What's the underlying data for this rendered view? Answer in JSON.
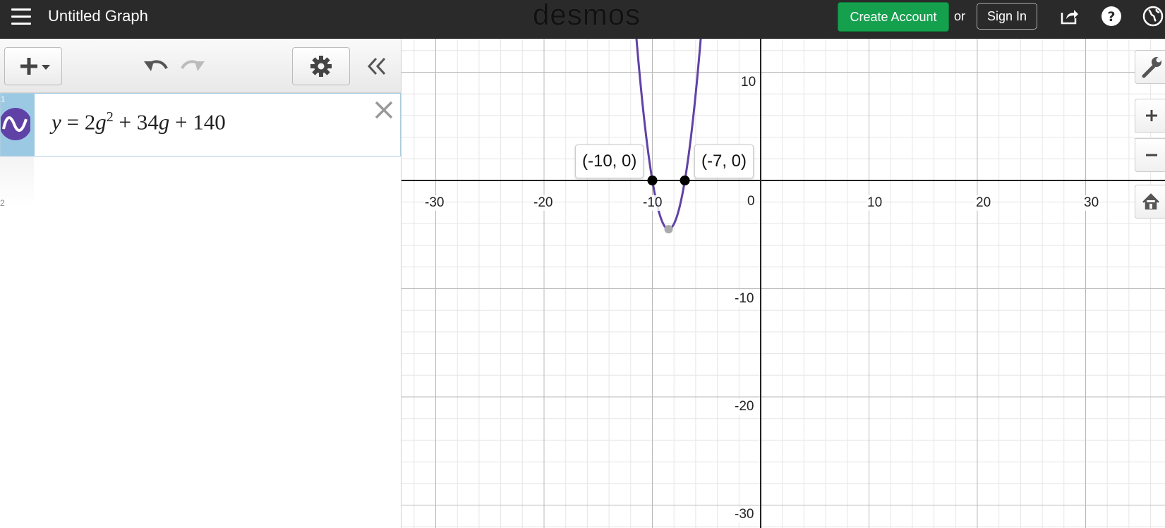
{
  "header": {
    "title": "Untitled Graph",
    "brand": "desmos",
    "create_account_label": "Create Account",
    "or_text": "or",
    "sign_in_label": "Sign In"
  },
  "expression_list": {
    "items": [
      {
        "index": "1",
        "latex": "y = 2g^2 + 34g + 140",
        "color": "#6042a6"
      }
    ],
    "next_index": "2"
  },
  "graph": {
    "x_ticks": [
      "-30",
      "-20",
      "-10",
      "0",
      "10",
      "20",
      "30"
    ],
    "y_ticks": [
      "10",
      "-10",
      "-20",
      "-30"
    ],
    "curve_color": "#6042a6",
    "point_labels": [
      "(-10, 0)",
      "(-7, 0)"
    ],
    "points": [
      [
        -10,
        0
      ],
      [
        -7,
        0
      ]
    ],
    "vertex": [
      -8.5,
      -4.5
    ]
  }
}
